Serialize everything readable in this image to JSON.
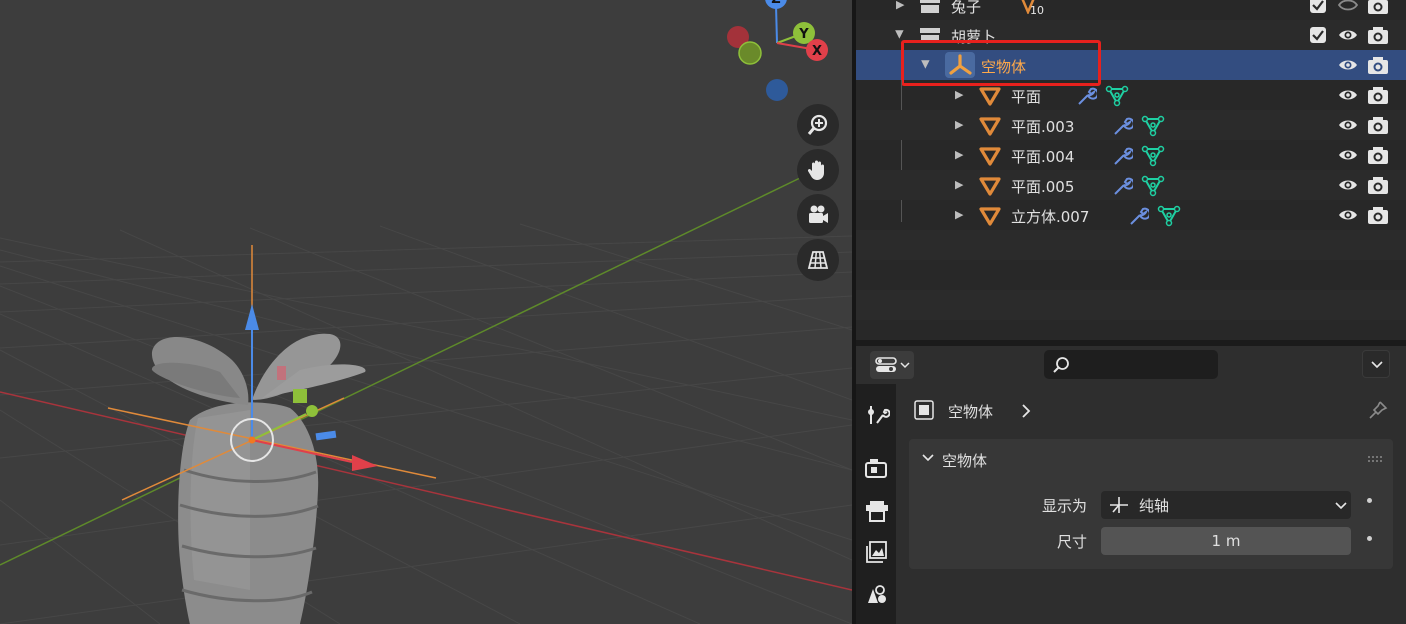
{
  "viewport": {
    "gizmo": {
      "x_label": "X",
      "y_label": "Y",
      "z_label": "Z"
    },
    "nav_buttons": [
      "zoom-icon",
      "hand-pan-icon",
      "camera-icon",
      "perspective-grid-icon"
    ]
  },
  "outliner": {
    "rows": [
      {
        "name": "兔子",
        "badge": "10"
      },
      {
        "name": "胡萝卜"
      },
      {
        "name": "空物体"
      },
      {
        "name": "平面"
      },
      {
        "name": "平面.003"
      },
      {
        "name": "平面.004"
      },
      {
        "name": "平面.005"
      },
      {
        "name": "立方体.007"
      }
    ]
  },
  "properties": {
    "breadcrumb": "空物体",
    "panel_title": "空物体",
    "display_as_label": "显示为",
    "display_as_value": "纯轴",
    "size_label": "尺寸",
    "size_value": "1 m",
    "search_placeholder": ""
  },
  "colors": {
    "selected_row": "#334d80",
    "highlight_box": "#e8211d",
    "object_orange": "#e08a3a",
    "modifier_blue": "#6b8fdf",
    "mesh_green": "#1fd0a3"
  }
}
